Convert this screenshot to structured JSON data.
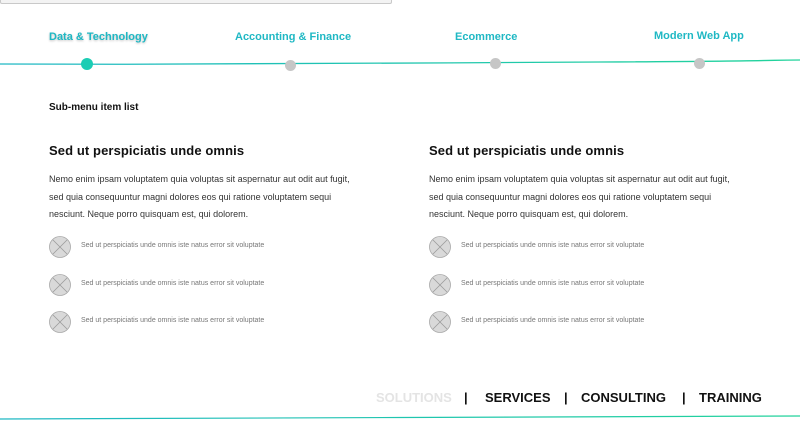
{
  "tabs": [
    {
      "label": "Data & Technology",
      "active": true
    },
    {
      "label": "Accounting & Finance",
      "active": false
    },
    {
      "label": "Ecommerce",
      "active": false
    },
    {
      "label": "Modern Web App",
      "active": false
    }
  ],
  "submenu": {
    "title": "Sub-menu item list"
  },
  "columns": [
    {
      "heading": "Sed ut perspiciatis unde omnis",
      "paragraph_lines": [
        "Nemo enim ipsam voluptatem quia voluptas sit aspernatur aut odit aut fugit,",
        "sed quia consequuntur magni dolores eos qui ratione voluptatem sequi",
        "nesciunt. Neque porro quisquam est, qui dolorem."
      ],
      "items": [
        "Sed ut perspiciatis unde omnis iste natus error sit voluptate",
        "Sed ut perspiciatis unde omnis iste natus error sit voluptate",
        "Sed ut perspiciatis unde omnis iste natus error sit voluptate"
      ]
    },
    {
      "heading": "Sed ut perspiciatis unde omnis",
      "paragraph_lines": [
        "Nemo enim ipsam voluptatem quia voluptas sit aspernatur aut odit aut fugit,",
        "sed quia consequuntur magni dolores eos qui ratione voluptatem sequi",
        "nesciunt. Neque porro quisquam est, qui dolorem."
      ],
      "items": [
        "Sed ut perspiciatis unde omnis iste natus error sit voluptate",
        "Sed ut perspiciatis unde omnis iste natus error sit voluptate",
        "Sed ut perspiciatis unde omnis iste natus error sit voluptate"
      ]
    }
  ],
  "footer_nav": {
    "items": [
      "SOLUTIONS",
      "SERVICES",
      "CONSULTING",
      "TRAINING"
    ],
    "separator": "|",
    "active_index": 0
  },
  "colors": {
    "accent": "#1fb8c4",
    "active_dot": "#1ccdb4",
    "inactive_dot": "#c6c6c6",
    "line_start": "#1fb8c4",
    "line_end": "#22d39b"
  },
  "icons": {
    "list_item": "placeholder-x-icon"
  }
}
